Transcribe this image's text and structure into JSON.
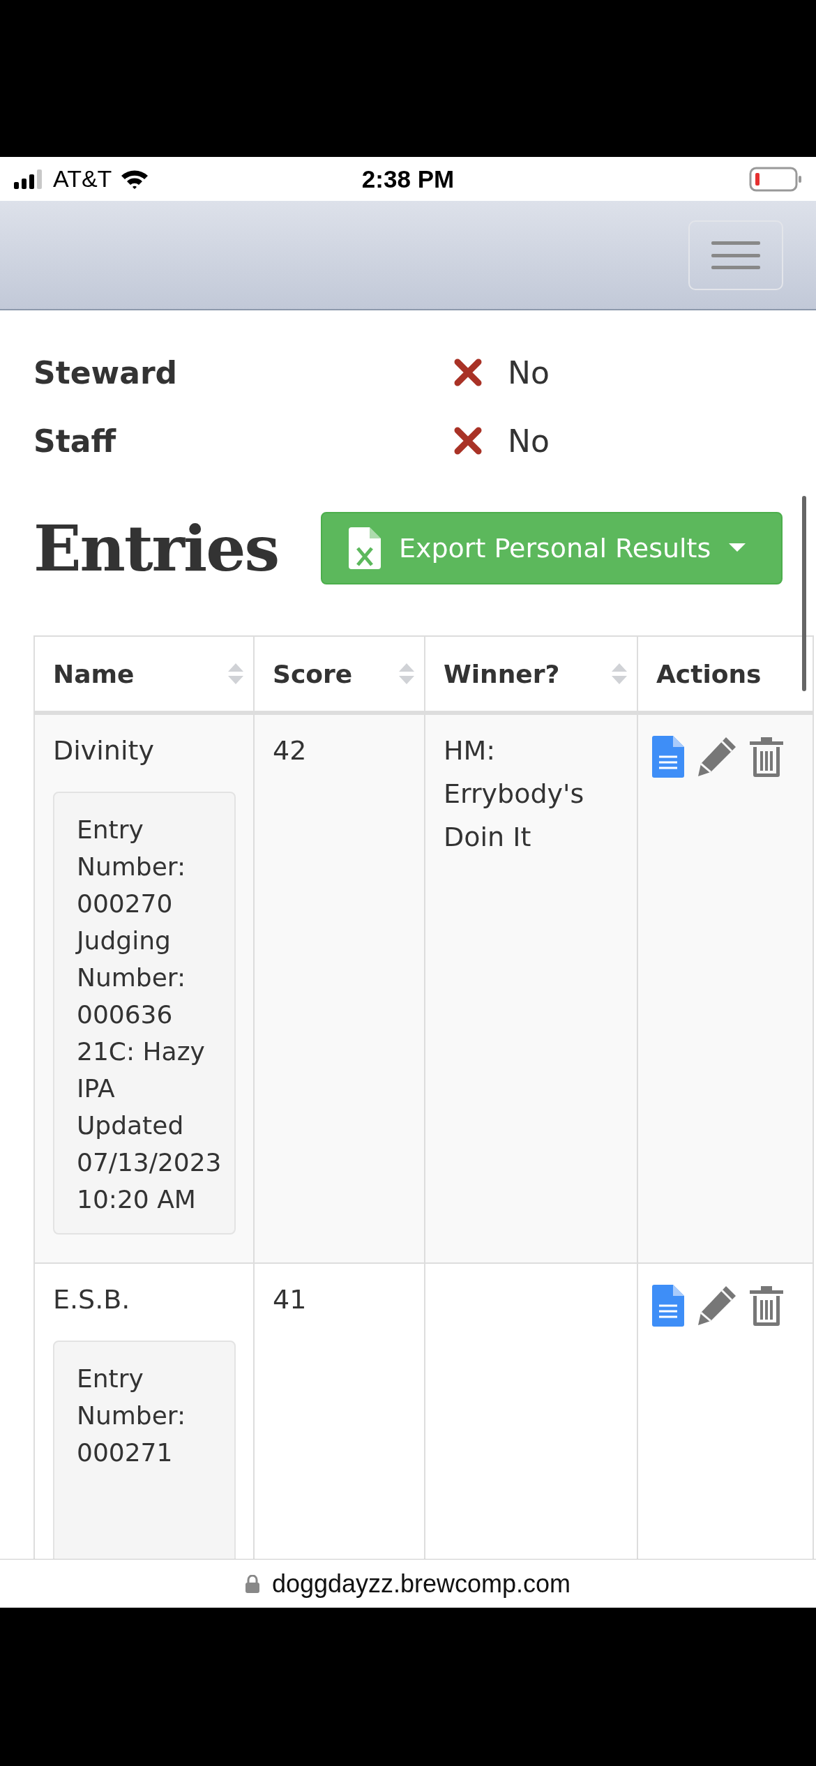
{
  "status_bar": {
    "carrier": "AT&T",
    "time": "2:38 PM"
  },
  "roles": [
    {
      "label": "Steward",
      "value": "No",
      "granted": false
    },
    {
      "label": "Staff",
      "value": "No",
      "granted": false
    }
  ],
  "section_title": "Entries",
  "export_button": {
    "label": "Export Personal Results"
  },
  "table": {
    "columns": [
      {
        "label": "Name",
        "sortable": true
      },
      {
        "label": "Score",
        "sortable": true
      },
      {
        "label": "Winner?",
        "sortable": true
      },
      {
        "label": "Actions",
        "sortable": false
      }
    ],
    "rows": [
      {
        "name": "Divinity",
        "details": [
          "Entry Number: 000270",
          "Judging Number: 000636",
          "21C: Hazy IPA",
          "Updated 07/13/2023 10:20 AM"
        ],
        "score": "42",
        "winner": "HM: Errybody's Doin It"
      },
      {
        "name": "E.S.B.",
        "details": [
          "Entry Number: 000271"
        ],
        "score": "41",
        "winner": ""
      }
    ]
  },
  "address_bar": {
    "url": "doggdayzz.brewcomp.com"
  }
}
